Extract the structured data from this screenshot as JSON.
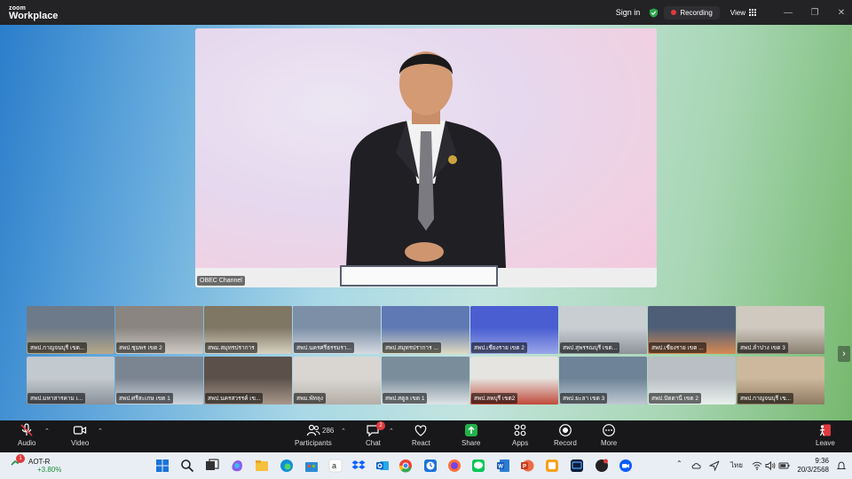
{
  "app": {
    "logo_line1": "zoom",
    "logo_line2": "Workplace"
  },
  "titlebar": {
    "sign_in": "Sign in",
    "recording": "Recording",
    "view": "View",
    "recording_color": "#e0393e",
    "shield_color": "#2ca84a"
  },
  "speaker": {
    "channel_label": "OBEC Channel"
  },
  "gallery": {
    "tiles": [
      {
        "label": "สพป.กาญจนบุรี เขต..."
      },
      {
        "label": "สพป.ชุมพร เขต 2"
      },
      {
        "label": "สพม.สมุทรปราการ"
      },
      {
        "label": "สพป.นครศรีธรรมรา..."
      },
      {
        "label": "สพป.สมุทรปราการ ..."
      },
      {
        "label": "สพป.เชียงราย เขต 2"
      },
      {
        "label": "สพป.สุพรรณบุรี เขต..."
      },
      {
        "label": "สพป.เชียงราย เขต ..."
      },
      {
        "label": "สพป.ลำปาง เขต 3"
      },
      {
        "label": "สพป.มหาสารคาม เ..."
      },
      {
        "label": "สพป.ศรีสะเกษ เขต 1"
      },
      {
        "label": "สพป.นครสวรรค์ เข..."
      },
      {
        "label": "สพม.พัทลุง"
      },
      {
        "label": "สพป.สตูล เขต 1"
      },
      {
        "label": "สพป.ลพบุรี เขต2"
      },
      {
        "label": "สพป.ยะลา เขต 3"
      },
      {
        "label": "สพป.ปัตตานี เขต 2"
      },
      {
        "label": "สพป.กาญจนบุรี เข..."
      }
    ]
  },
  "controls": {
    "audio": "Audio",
    "video": "Video",
    "participants": "Participants",
    "participants_count": "286",
    "chat": "Chat",
    "chat_badge": "2",
    "react": "React",
    "share": "Share",
    "apps": "Apps",
    "record": "Record",
    "more": "More",
    "leave": "Leave"
  },
  "taskbar": {
    "stock_name": "AOT-R",
    "stock_change": "+3.80%",
    "stock_badge": "1",
    "lang": "ไทย",
    "time": "9:36",
    "date": "20/3/2568"
  }
}
